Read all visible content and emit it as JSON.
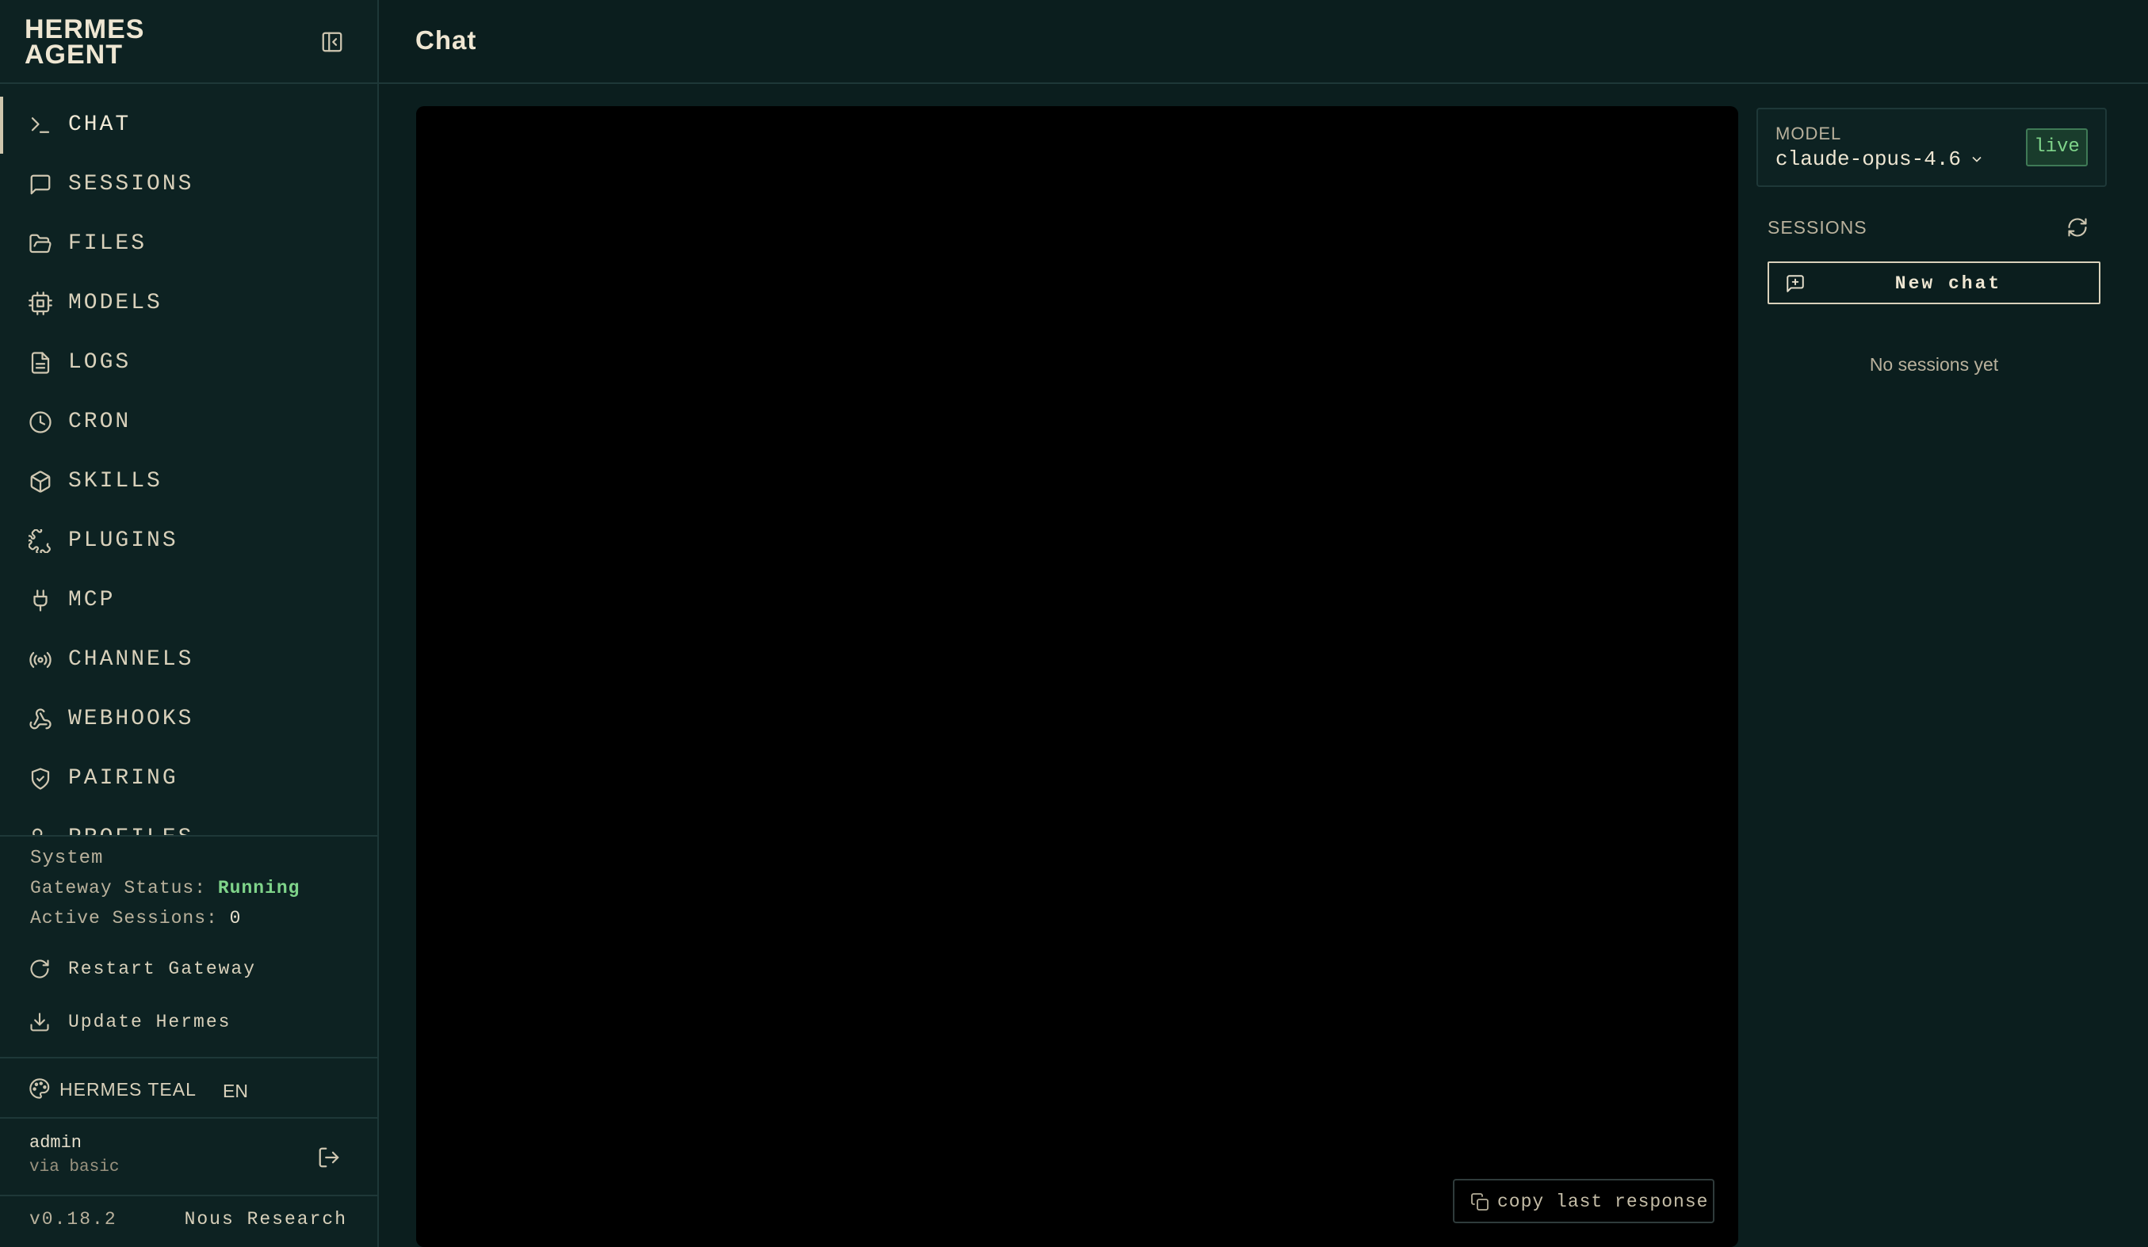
{
  "brand": {
    "line1": "HERMES",
    "line2": "AGENT"
  },
  "header": {
    "title": "Chat"
  },
  "nav": [
    {
      "label": "CHAT",
      "icon": "terminal-icon",
      "active": true
    },
    {
      "label": "SESSIONS",
      "icon": "message-square-icon"
    },
    {
      "label": "FILES",
      "icon": "folder-icon"
    },
    {
      "label": "MODELS",
      "icon": "cpu-icon"
    },
    {
      "label": "LOGS",
      "icon": "file-text-icon"
    },
    {
      "label": "CRON",
      "icon": "clock-icon"
    },
    {
      "label": "SKILLS",
      "icon": "package-icon"
    },
    {
      "label": "PLUGINS",
      "icon": "puzzle-icon"
    },
    {
      "label": "MCP",
      "icon": "plug-icon"
    },
    {
      "label": "CHANNELS",
      "icon": "radio-icon"
    },
    {
      "label": "WEBHOOKS",
      "icon": "webhook-icon"
    },
    {
      "label": "PAIRING",
      "icon": "shield-icon"
    },
    {
      "label": "PROFILES",
      "icon": "users-icon"
    }
  ],
  "system": {
    "title": "System",
    "gateway_label": "Gateway Status:",
    "gateway_value": "Running",
    "sessions_label": "Active Sessions:",
    "sessions_value": "0",
    "restart_label": "Restart Gateway",
    "update_label": "Update Hermes"
  },
  "theme": {
    "name": "HERMES TEAL",
    "language": "EN"
  },
  "user": {
    "name": "admin",
    "auth": "via basic"
  },
  "footer": {
    "version": "v0.18.2",
    "vendor": "Nous Research"
  },
  "chat": {
    "copy_label": "copy last response"
  },
  "model": {
    "label": "MODEL",
    "value": "claude-opus-4.6",
    "badge": "live"
  },
  "sessions": {
    "title": "SESSIONS",
    "new_chat": "New chat",
    "empty": "No sessions yet"
  },
  "colors": {
    "background": "#0b1e1e",
    "sidebar": "#0d2222",
    "border": "#1e3838",
    "text": "#e6dfcc",
    "running": "#7fd48a",
    "chat_bg": "#000000"
  }
}
